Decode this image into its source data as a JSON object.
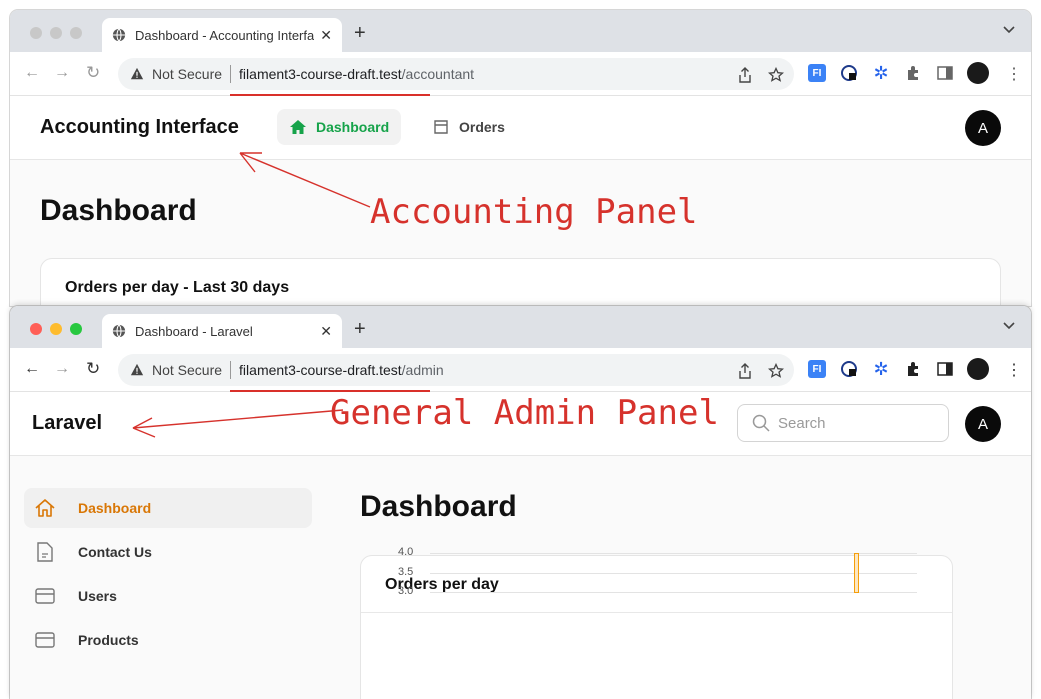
{
  "window1": {
    "tab_title": "Dashboard - Accounting Interface",
    "new_tab": "+",
    "not_secure": "Not Secure",
    "url_host": "filament3-course-draft.test",
    "url_path": "/accountant",
    "brand": "Accounting Interface",
    "nav": [
      "Dashboard",
      "Orders"
    ],
    "avatar": "A",
    "heading": "Dashboard",
    "widget_title": "Orders per day - Last 30 days"
  },
  "window2": {
    "tab_title": "Dashboard - Laravel",
    "new_tab": "+",
    "not_secure": "Not Secure",
    "url_host": "filament3-course-draft.test",
    "url_path": "/admin",
    "brand": "Laravel",
    "search_placeholder": "Search",
    "avatar": "A",
    "sidebar": [
      "Dashboard",
      "Contact Us",
      "Users",
      "Products"
    ],
    "heading": "Dashboard",
    "widget_title": "Orders per day",
    "y_ticks": [
      "4.0",
      "3.5",
      "3.0"
    ]
  },
  "annotations": {
    "accounting": "Accounting Panel",
    "admin": "General Admin Panel"
  },
  "colors": {
    "accent_green": "#16a34a",
    "accent_orange": "#d97706",
    "annotation_red": "#d6322c"
  },
  "chart_data": {
    "type": "bar",
    "ylim": [
      3.0,
      4.0
    ],
    "visible_ticks": [
      4.0,
      3.5,
      3.0
    ],
    "values": [
      4.0
    ]
  }
}
